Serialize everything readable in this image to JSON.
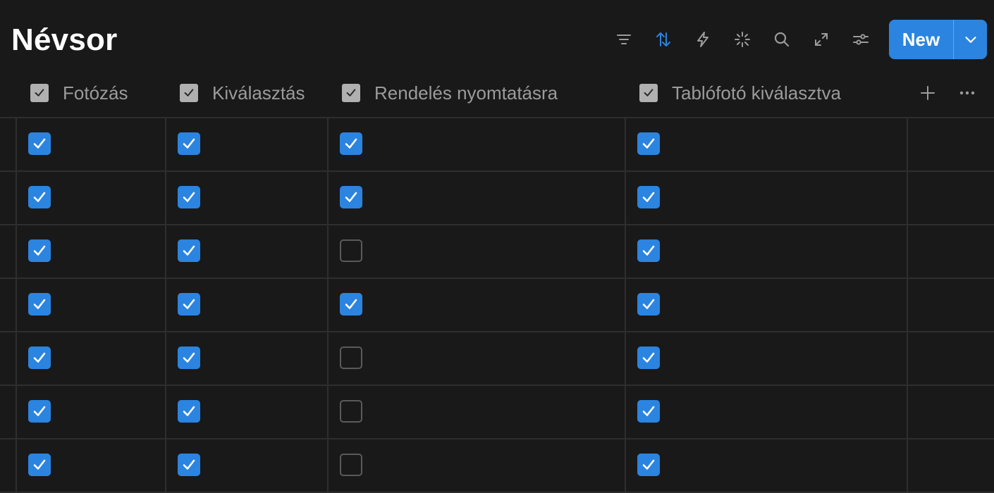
{
  "page": {
    "title": "Névsor"
  },
  "toolbar": {
    "icons": [
      "filter-icon",
      "sort-icon",
      "automation-icon",
      "ai-sparkle-icon",
      "search-icon",
      "expand-icon",
      "settings-sliders-icon"
    ],
    "active_icon": "sort-icon",
    "new_button_label": "New",
    "accent": "#2b84e0"
  },
  "table": {
    "columns": [
      {
        "label": "Fotózás",
        "icon": "checkbox-property-icon"
      },
      {
        "label": "Kiválasztás",
        "icon": "checkbox-property-icon"
      },
      {
        "label": "Rendelés nyomtatásra",
        "icon": "checkbox-property-icon"
      },
      {
        "label": "Tablófotó kiválasztva",
        "icon": "checkbox-property-icon"
      }
    ],
    "rows": [
      [
        true,
        true,
        true,
        true
      ],
      [
        true,
        true,
        true,
        true
      ],
      [
        true,
        true,
        false,
        true
      ],
      [
        true,
        true,
        true,
        true
      ],
      [
        true,
        true,
        false,
        true
      ],
      [
        true,
        true,
        false,
        true
      ],
      [
        true,
        true,
        false,
        true
      ]
    ],
    "header_actions": [
      "add-property-icon",
      "more-icon"
    ]
  }
}
